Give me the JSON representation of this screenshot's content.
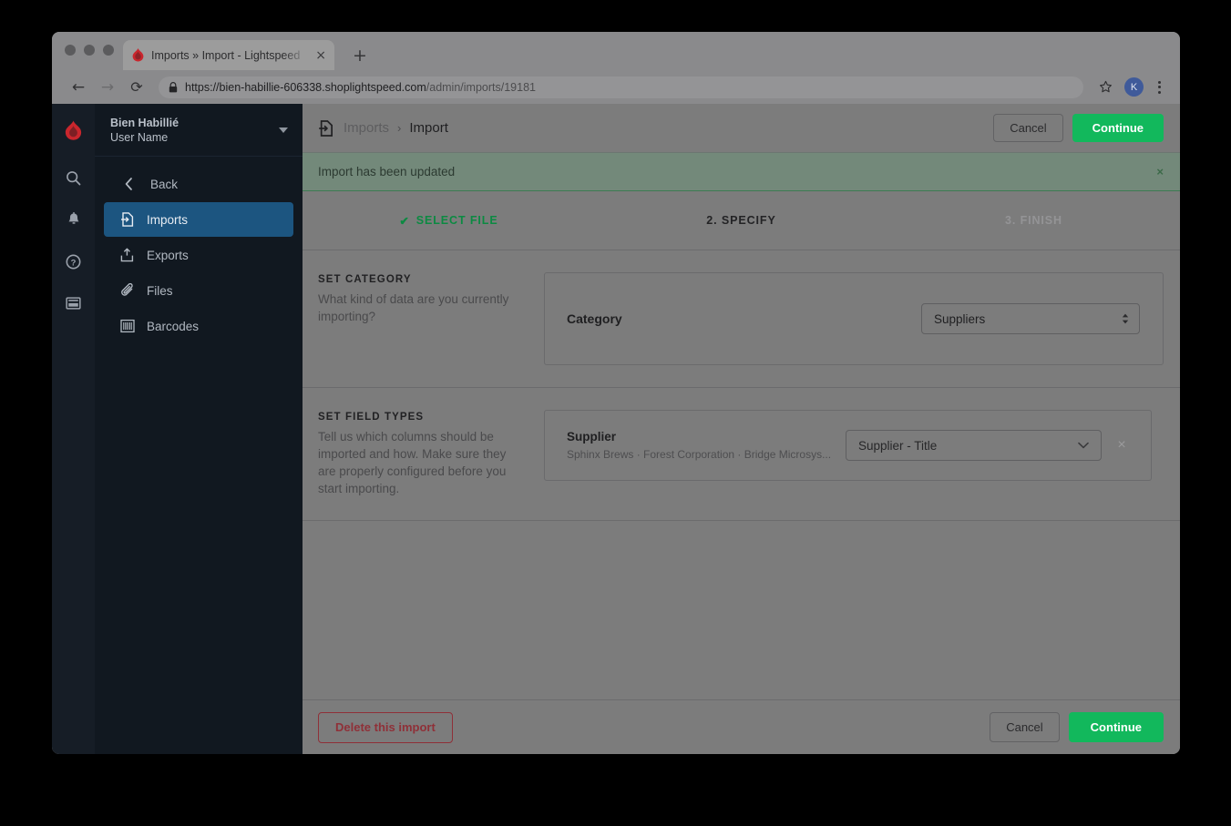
{
  "browser": {
    "tab": {
      "title": "Imports » Import - Lightspeed",
      "favicon": "lightspeed-flame-icon",
      "close_label": "×"
    },
    "new_tab_label": "+",
    "nav": {
      "back_label": "←",
      "forward_label": "→",
      "reload_label": "⟳"
    },
    "omnibox": {
      "lock": "lock-icon",
      "url_scheme_host": "https://bien-habillie-606338.shoplightspeed.com",
      "url_path": "/admin/imports/19181"
    },
    "star_label": "☆",
    "avatar_initial": "K"
  },
  "rail": {
    "logo": "lightspeed-flame-icon",
    "icons": [
      "search-icon",
      "bell-icon",
      "help-circle-icon",
      "register-icon"
    ]
  },
  "sidebar": {
    "shop_name": "Bien Habillié",
    "user_name": "User Name",
    "items": [
      {
        "label": "Back",
        "icon": "chevron-left-icon",
        "active": false
      },
      {
        "label": "Imports",
        "icon": "import-file-icon",
        "active": true
      },
      {
        "label": "Exports",
        "icon": "export-upload-icon",
        "active": false
      },
      {
        "label": "Files",
        "icon": "paperclip-icon",
        "active": false
      },
      {
        "label": "Barcodes",
        "icon": "barcode-icon",
        "active": false
      }
    ]
  },
  "header": {
    "breadcrumb_icon": "import-file-icon",
    "breadcrumb_parent": "Imports",
    "breadcrumb_separator": "›",
    "breadcrumb_current": "Import",
    "cancel_label": "Cancel",
    "continue_label": "Continue"
  },
  "alert": {
    "message": "Import has been updated",
    "close_label": "×"
  },
  "steps": [
    {
      "label": "SELECT FILE",
      "state": "done",
      "check": "✔"
    },
    {
      "label": "2. SPECIFY",
      "state": "current"
    },
    {
      "label": "3. FINISH",
      "state": "todo"
    }
  ],
  "set_category": {
    "title": "SET CATEGORY",
    "description": "What kind of data are you currently importing?",
    "field_label": "Category",
    "selected_value": "Suppliers"
  },
  "set_field_types": {
    "title": "SET FIELD TYPES",
    "description": "Tell us which columns should be imported and how. Make sure they are properly configured before you start importing.",
    "fields": [
      {
        "name": "Supplier",
        "sample": "Sphinx Brews · Forest Corporation · Bridge Microsys...",
        "mapping": "Supplier - Title",
        "remove_label": "×"
      }
    ]
  },
  "footer": {
    "delete_label": "Delete this import",
    "cancel_label": "Cancel",
    "continue_label": "Continue"
  },
  "colors": {
    "brand_green": "#12b85c",
    "danger_red": "#8f3038",
    "sidebar_active": "#1c5580",
    "alert_green": "#73897a"
  }
}
